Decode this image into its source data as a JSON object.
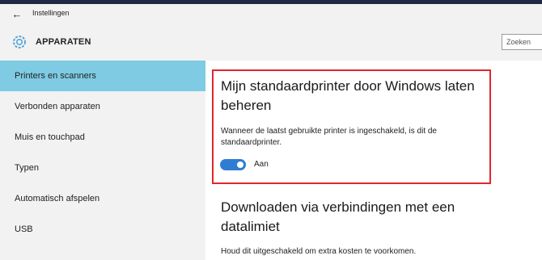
{
  "window": {
    "title": "Instellingen",
    "back_glyph": "←"
  },
  "header": {
    "section_title": "APPARATEN",
    "icon": "gear-icon",
    "search_placeholder": "Zoeken"
  },
  "sidebar": {
    "items": [
      {
        "label": "Printers en scanners",
        "selected": true
      },
      {
        "label": "Verbonden apparaten",
        "selected": false
      },
      {
        "label": "Muis en touchpad",
        "selected": false
      },
      {
        "label": "Typen",
        "selected": false
      },
      {
        "label": "Automatisch afspelen",
        "selected": false
      },
      {
        "label": "USB",
        "selected": false
      }
    ]
  },
  "main": {
    "default_printer": {
      "heading": "Mijn standaardprinter door Windows laten beheren",
      "description": "Wanneer de laatst gebruikte printer is ingeschakeld, is dit de standaardprinter.",
      "toggle_on": true,
      "toggle_label": "Aan"
    },
    "metered": {
      "heading": "Downloaden via verbindingen met een datalimiet",
      "description": "Houd dit uitgeschakeld om extra kosten te voorkomen."
    }
  },
  "colors": {
    "selected_nav": "#7ecbe3",
    "toggle_on": "#2f7dd3",
    "highlight_border": "#e0262d"
  }
}
